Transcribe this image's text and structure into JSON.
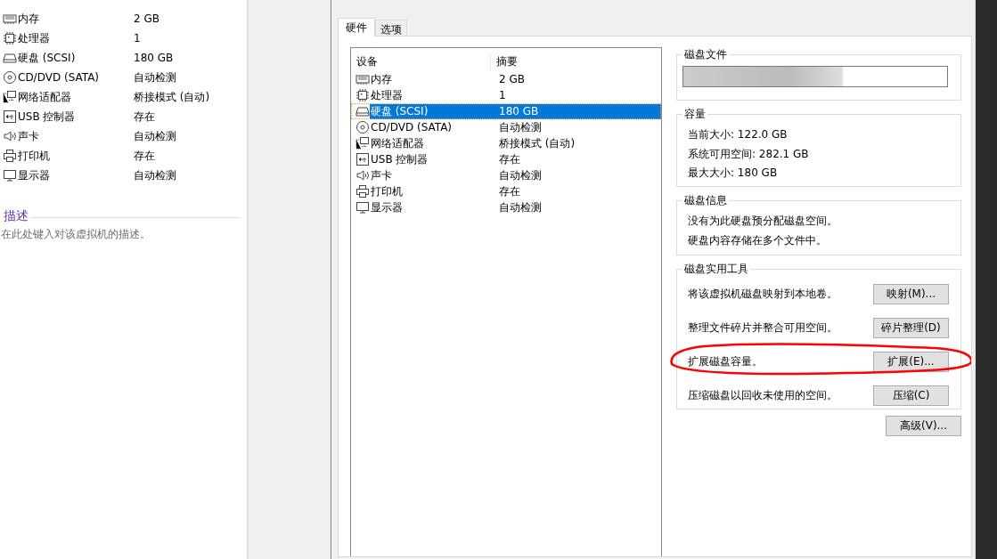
{
  "summary": {
    "devices": [
      {
        "kind": "memory",
        "name": "内存",
        "value": "2 GB"
      },
      {
        "kind": "cpu",
        "name": "处理器",
        "value": "1"
      },
      {
        "kind": "disk",
        "name": "硬盘 (SCSI)",
        "value": "180 GB"
      },
      {
        "kind": "cd",
        "name": "CD/DVD (SATA)",
        "value": "自动检测"
      },
      {
        "kind": "network",
        "name": "网络适配器",
        "value": "桥接模式 (自动)"
      },
      {
        "kind": "usb",
        "name": "USB 控制器",
        "value": "存在"
      },
      {
        "kind": "sound",
        "name": "声卡",
        "value": "自动检测"
      },
      {
        "kind": "printer",
        "name": "打印机",
        "value": "存在"
      },
      {
        "kind": "display",
        "name": "显示器",
        "value": "自动检测"
      }
    ],
    "description": {
      "heading": "描述",
      "text": "在此处键入对该虚拟机的描述。"
    }
  },
  "dialog": {
    "tabs": [
      {
        "label": "硬件",
        "selected": true
      },
      {
        "label": "选项",
        "selected": false
      }
    ],
    "device_table": {
      "columns": [
        "设备",
        "摘要"
      ],
      "rows": [
        {
          "kind": "memory",
          "name": "内存",
          "value": "2 GB",
          "selected": false
        },
        {
          "kind": "cpu",
          "name": "处理器",
          "value": "1",
          "selected": false
        },
        {
          "kind": "disk",
          "name": "硬盘 (SCSI)",
          "value": "180 GB",
          "selected": true
        },
        {
          "kind": "cd",
          "name": "CD/DVD (SATA)",
          "value": "自动检测",
          "selected": false
        },
        {
          "kind": "network",
          "name": "网络适配器",
          "value": "桥接模式 (自动)",
          "selected": false
        },
        {
          "kind": "usb",
          "name": "USB 控制器",
          "value": "存在",
          "selected": false
        },
        {
          "kind": "sound",
          "name": "声卡",
          "value": "自动检测",
          "selected": false
        },
        {
          "kind": "printer",
          "name": "打印机",
          "value": "存在",
          "selected": false
        },
        {
          "kind": "display",
          "name": "显示器",
          "value": "自动检测",
          "selected": false
        }
      ]
    },
    "disk_file": {
      "title": "磁盘文件"
    },
    "capacity": {
      "title": "容量",
      "lines": [
        "当前大小: 122.0 GB",
        "系统可用空间: 282.1 GB",
        "最大大小: 180 GB"
      ]
    },
    "disk_info": {
      "title": "磁盘信息",
      "lines": [
        "没有为此硬盘预分配磁盘空间。",
        "硬盘内容存储在多个文件中。"
      ]
    },
    "utilities": {
      "title": "磁盘实用工具",
      "rows": [
        {
          "text": "将该虚拟机磁盘映射到本地卷。",
          "button": "映射(M)...",
          "highlighted": false
        },
        {
          "text": "整理文件碎片并整合可用空间。",
          "button": "碎片整理(D)",
          "highlighted": false
        },
        {
          "text": "扩展磁盘容量。",
          "button": "扩展(E)...",
          "highlighted": true
        },
        {
          "text": "压缩磁盘以回收未使用的空间。",
          "button": "压缩(C)",
          "highlighted": false
        }
      ]
    },
    "advanced_button": "高级(V)..."
  }
}
